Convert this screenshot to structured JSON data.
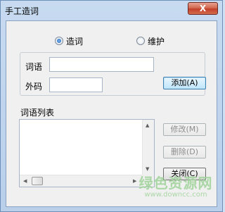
{
  "window": {
    "title": "手工造词",
    "close_label": "X"
  },
  "mode": {
    "options": [
      {
        "label": "造词",
        "selected": true
      },
      {
        "label": "维护",
        "selected": false
      }
    ]
  },
  "form": {
    "word_label": "词语",
    "word_value": "",
    "code_label": "外码",
    "code_value": "",
    "add_button": "添加(A)"
  },
  "list": {
    "label": "词语列表",
    "items": []
  },
  "actions": {
    "modify_button": "修改(M)",
    "delete_button": "删除(D)",
    "close_button": "关闭(C)"
  },
  "watermark": {
    "main": "绿色资源网",
    "url": "www.downcc.com"
  },
  "colors": {
    "frame": "#c7daf0",
    "client": "#f0f0f0",
    "close_red": "#c3412a",
    "watermark_green": "#9fd39a"
  }
}
